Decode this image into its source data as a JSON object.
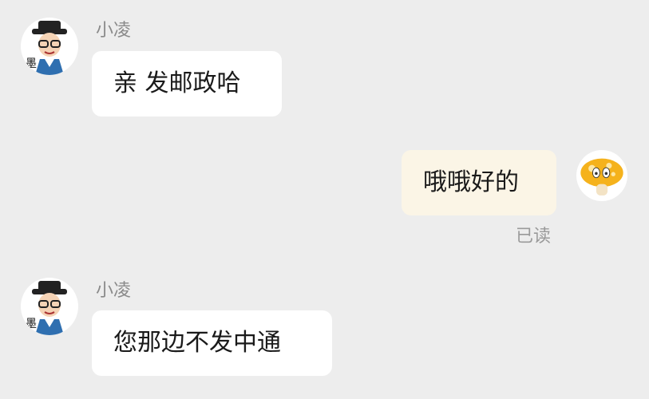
{
  "chat": {
    "messages": [
      {
        "sender": "小凌",
        "text": "亲 发邮政哈",
        "direction": "incoming",
        "avatar": "cartoon-man-avatar"
      },
      {
        "text": "哦哦好的",
        "direction": "outgoing",
        "status": "已读",
        "avatar": "mushroom-avatar"
      },
      {
        "sender": "小凌",
        "text": "您那边不发中通",
        "direction": "incoming",
        "avatar": "cartoon-man-avatar"
      }
    ]
  },
  "colors": {
    "background": "#ededed",
    "incoming_bubble": "#ffffff",
    "outgoing_bubble": "#fbf5e6",
    "secondary_text": "#8a8a8a"
  }
}
